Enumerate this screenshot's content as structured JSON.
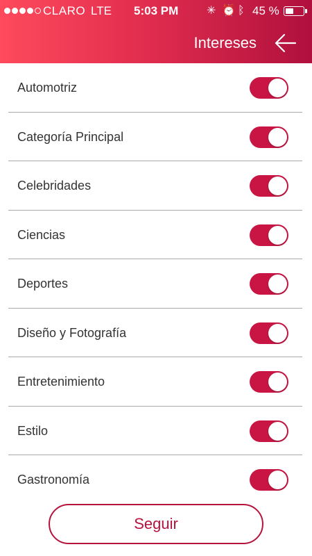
{
  "status_bar": {
    "carrier": "CLARO",
    "network": "LTE",
    "time": "5:03 PM",
    "battery_percent": "45 %",
    "battery_level": 0.45,
    "signal_bars_filled": 4,
    "signal_bars_total": 5
  },
  "header": {
    "title": "Intereses",
    "back_icon": "arrow-left-icon"
  },
  "interests": [
    {
      "label": "Automotriz",
      "enabled": true
    },
    {
      "label": "Categoría Principal",
      "enabled": true
    },
    {
      "label": "Celebridades",
      "enabled": true
    },
    {
      "label": "Ciencias",
      "enabled": true
    },
    {
      "label": "Deportes",
      "enabled": true
    },
    {
      "label": "Diseño y Fotografía",
      "enabled": true
    },
    {
      "label": "Entretenimiento",
      "enabled": true
    },
    {
      "label": "Estilo",
      "enabled": true
    },
    {
      "label": "Gastronomía",
      "enabled": true
    }
  ],
  "follow_button": {
    "label": "Seguir"
  },
  "colors": {
    "accent": "#c81543",
    "header_start": "#ff4a5c",
    "header_end": "#b0103d"
  }
}
